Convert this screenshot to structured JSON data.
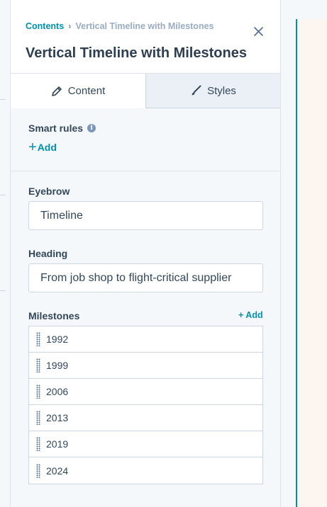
{
  "breadcrumb": {
    "root": "Contents",
    "separator": "›",
    "current": "Vertical Timeline with Milestones"
  },
  "title": "Vertical Timeline with Milestones",
  "tabs": [
    {
      "label": "Content",
      "icon": "pencil-icon",
      "active": true
    },
    {
      "label": "Styles",
      "icon": "brush-icon",
      "active": false
    }
  ],
  "smart_rules": {
    "label": "Smart rules",
    "add_label": "Add"
  },
  "fields": {
    "eyebrow": {
      "label": "Eyebrow",
      "value": "Timeline"
    },
    "heading": {
      "label": "Heading",
      "value": "From job shop to flight-critical supplier"
    }
  },
  "milestones": {
    "label": "Milestones",
    "add_label": "+ Add",
    "items": [
      "1992",
      "1999",
      "2006",
      "2013",
      "2019",
      "2024"
    ]
  },
  "colors": {
    "accent": "#0091ae",
    "text": "#33475b",
    "border": "#cbd6e2",
    "preview_bg": "#fcf5f0"
  }
}
